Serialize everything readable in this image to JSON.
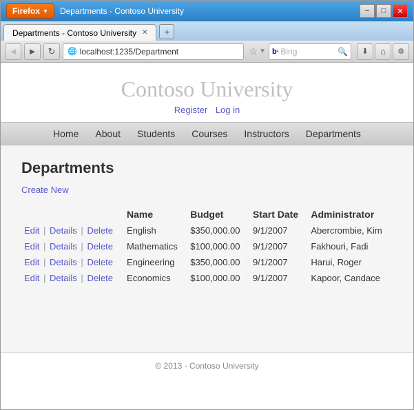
{
  "browser": {
    "title": "Departments - Contoso University",
    "firefox_label": "Firefox",
    "address": "localhost:1235/Department",
    "search_placeholder": "Bing",
    "new_tab_symbol": "+",
    "minimize": "−",
    "maximize": "□",
    "close": "✕",
    "back": "◄",
    "forward": "►",
    "refresh": "↻",
    "home": "⌂"
  },
  "site": {
    "title": "Contoso University",
    "register": "Register",
    "login": "Log in"
  },
  "nav": {
    "items": [
      {
        "label": "Home",
        "href": "#"
      },
      {
        "label": "About",
        "href": "#"
      },
      {
        "label": "Students",
        "href": "#"
      },
      {
        "label": "Courses",
        "href": "#"
      },
      {
        "label": "Instructors",
        "href": "#"
      },
      {
        "label": "Departments",
        "href": "#"
      }
    ]
  },
  "page": {
    "heading": "Departments",
    "create_new": "Create New",
    "columns": {
      "name": "Name",
      "budget": "Budget",
      "start_date": "Start Date",
      "administrator": "Administrator"
    },
    "rows": [
      {
        "name": "English",
        "budget": "$350,000.00",
        "start_date": "9/1/2007",
        "administrator": "Abercrombie, Kim",
        "edit": "Edit",
        "details": "Details",
        "delete": "Delete"
      },
      {
        "name": "Mathematics",
        "budget": "$100,000.00",
        "start_date": "9/1/2007",
        "administrator": "Fakhouri, Fadi",
        "edit": "Edit",
        "details": "Details",
        "delete": "Delete"
      },
      {
        "name": "Engineering",
        "budget": "$350,000.00",
        "start_date": "9/1/2007",
        "administrator": "Harui, Roger",
        "edit": "Edit",
        "details": "Details",
        "delete": "Delete"
      },
      {
        "name": "Economics",
        "budget": "$100,000.00",
        "start_date": "9/1/2007",
        "administrator": "Kapoor, Candace",
        "edit": "Edit",
        "details": "Details",
        "delete": "Delete"
      }
    ]
  },
  "footer": {
    "text": "© 2013 - Contoso University"
  }
}
